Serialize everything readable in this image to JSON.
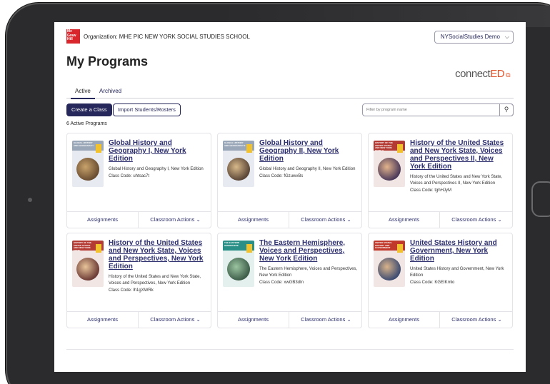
{
  "header": {
    "logo_text": "Mc Graw Hill",
    "organization": "Organization: MHE PIC NEW YORK SOCIAL STUDIES SCHOOL",
    "account_label": "NYSocialStudies Demo"
  },
  "page": {
    "title": "My Programs",
    "brand_left": "connect",
    "brand_right": "ED"
  },
  "tabs": [
    {
      "label": "Active",
      "selected": true
    },
    {
      "label": "Archived",
      "selected": false
    }
  ],
  "toolbar": {
    "create_class": "Create a Class",
    "import_students": "Import Students/Rosters",
    "filter_placeholder": "Filter by program name"
  },
  "programs_count": "6 Active Programs",
  "cards": [
    {
      "title": "Global History and Geography I, New York Edition",
      "description": "Global History and Geography I, New York Edition",
      "code": "Class Code: uhtsac7t",
      "cover_label": "GLOBAL HISTORY AND GEOGRAPHY I",
      "cover_color": "#e7eaf0",
      "band_color": "#9aa7b8",
      "assignments": "Assignments",
      "actions": "Classroom Actions"
    },
    {
      "title": "Global History and Geography II, New York Edition",
      "description": "Global History and Geography II, New York Edition",
      "code": "Class Code: fGzuwvBs",
      "cover_label": "GLOBAL HISTORY AND GEOGRAPHY II",
      "cover_color": "#e7eaf0",
      "band_color": "#9aa7b8",
      "assignments": "Assignments",
      "actions": "Classroom Actions"
    },
    {
      "title": "History of the United States and New York State, Voices and Perspectives II, New York Edition",
      "description": "History of the United States and New York State, Voices and Perspectives II, New York Edition",
      "code": "Class Code: tghHJyM",
      "cover_label": "HISTORY OF THE UNITED STATES AND NEW YORK STATE II",
      "cover_color": "#f2e6e4",
      "band_color": "#b43a34",
      "assignments": "Assignments",
      "actions": "Classroom Actions"
    },
    {
      "title": "History of the United States and New York State, Voices and Perspectives, New York Edition",
      "description": "History of the United States and New York State, Voices and Perspectives, New York Edition",
      "code": "Class Code: lh1gXWRk",
      "cover_label": "HISTORY OF THE UNITED STATES AND NEW YORK STATE",
      "cover_color": "#f2e6e4",
      "band_color": "#b43a34",
      "assignments": "Assignments",
      "actions": "Classroom Actions"
    },
    {
      "title": "The Eastern Hemisphere, Voices and Perspectives, New York Edition",
      "description": "The Eastern Hemisphere, Voices and Perspectives, New York Edition",
      "code": "Class Code: xwGB3dIn",
      "cover_label": "THE EASTERN HEMISPHERE",
      "cover_color": "#e3f0ee",
      "band_color": "#2a8f86",
      "assignments": "Assignments",
      "actions": "Classroom Actions"
    },
    {
      "title": "United States History and Government, New York Edition",
      "description": "United States History and Government, New York Edition",
      "code": "Class Code: KGEIKmlo",
      "cover_label": "UNITED STATES HISTORY AND GOVERNMENT",
      "cover_color": "#f2e6e4",
      "band_color": "#c0392b",
      "assignments": "Assignments",
      "actions": "Classroom Actions"
    }
  ],
  "icons": {
    "search": "search-icon",
    "chevron": "chevron-down-icon",
    "external": "external-link-icon"
  }
}
